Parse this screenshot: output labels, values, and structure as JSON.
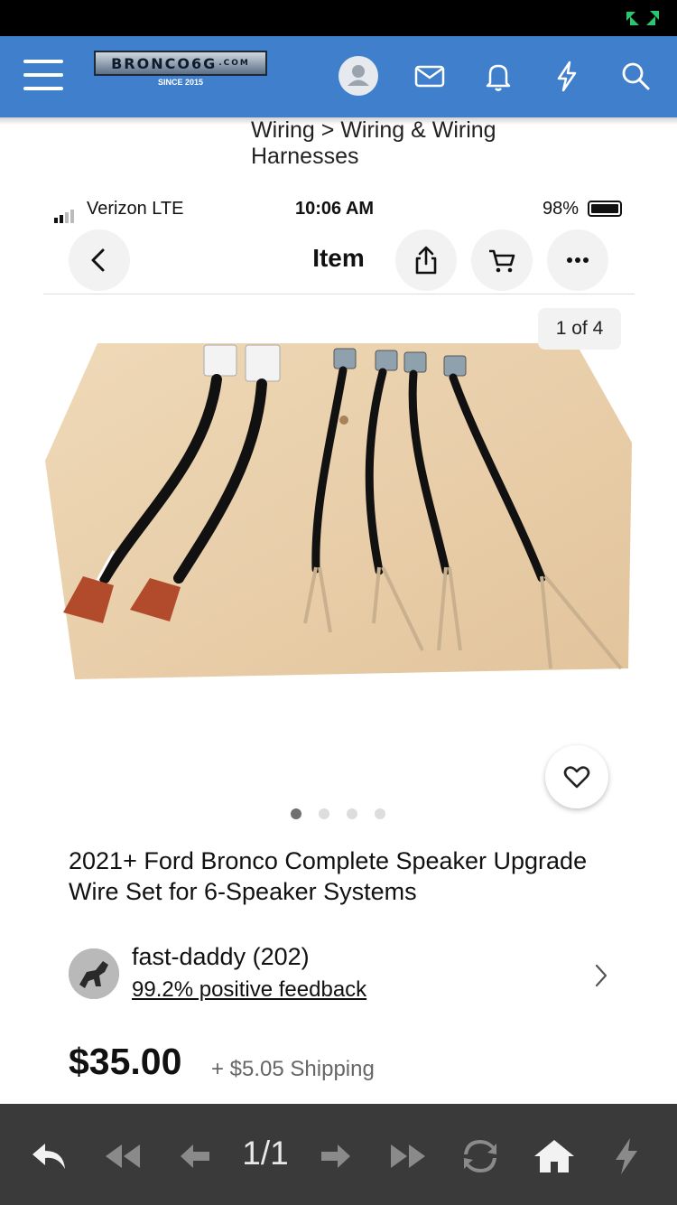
{
  "forum_header": {
    "logo_main": "BRONCO6G",
    "logo_domain": ".COM",
    "logo_sub": "SINCE 2015",
    "accent_color": "#3f7fcb"
  },
  "breadcrumb": "Wiring > Wiring & Wiring Harnesses",
  "ios_status": {
    "carrier": "Verizon  LTE",
    "time": "10:06 AM",
    "battery": "98%"
  },
  "nav": {
    "title": "Item",
    "icons": [
      "back-icon",
      "share-icon",
      "cart-icon",
      "more-icon"
    ]
  },
  "listing": {
    "image_counter": "1 of 4",
    "image_count": 4,
    "active_image": 1,
    "title": "2021+  Ford Bronco Complete Speaker Upgrade Wire Set for 6-Speaker Systems",
    "seller_name": "fast-daddy (202)",
    "seller_feedback": "99.2% positive feedback",
    "price": "$35.00",
    "shipping": "+ $5.05 Shipping"
  },
  "toolbar": {
    "page_indicator": "1/1",
    "icons": [
      "reply-icon",
      "first-page-icon",
      "prev-icon",
      "next-icon",
      "last-page-icon",
      "refresh-icon",
      "home-icon",
      "flash-icon"
    ]
  }
}
